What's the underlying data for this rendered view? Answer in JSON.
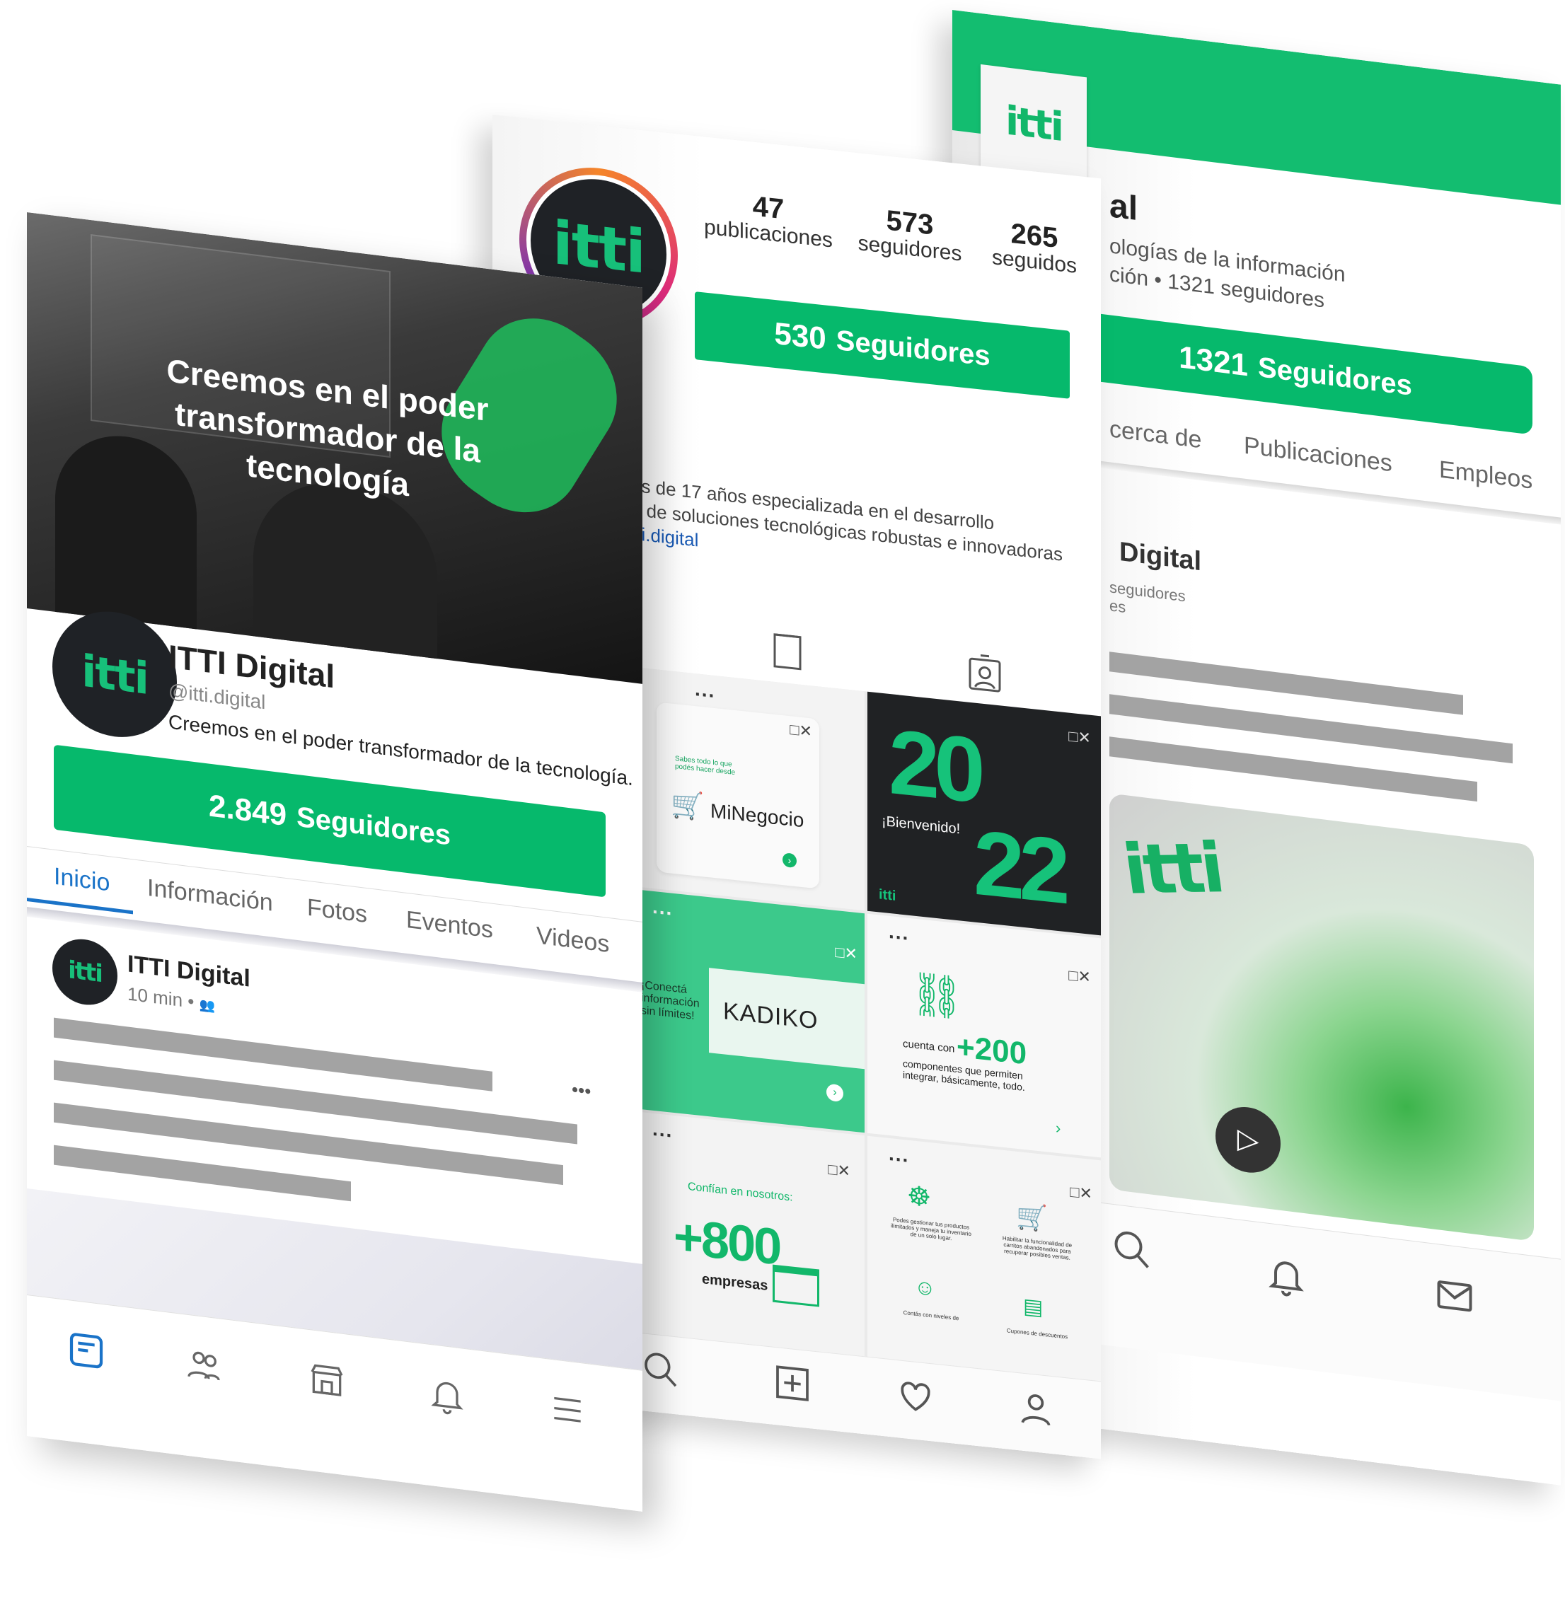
{
  "colors": {
    "brand_green": "#06b96c",
    "dark": "#1f2226",
    "link_blue": "#1a73c8"
  },
  "brand": {
    "logo_text": "itti"
  },
  "facebook": {
    "cover_text": "Creemos en el poder transformador de la tecnología",
    "page_name": "ITTI Digital",
    "handle": "@itti.digital",
    "description": "Creemos en el poder transformador de la tecnología.",
    "followers_number": "2.849",
    "followers_label": "Seguidores",
    "tabs": [
      "Inicio",
      "Información",
      "Fotos",
      "Eventos",
      "Videos"
    ],
    "post": {
      "author": "ITTI Digital",
      "time": "10 min •"
    },
    "post_menu": "•••",
    "bottom_nav_icons": [
      "news-feed-icon",
      "friends-icon",
      "marketplace-icon",
      "bell-icon",
      "menu-icon"
    ]
  },
  "instagram": {
    "stats": [
      {
        "value": "47",
        "label": "publicaciones"
      },
      {
        "value": "573",
        "label": "seguidores"
      },
      {
        "value": "265",
        "label": "seguidos"
      }
    ],
    "followers_number": "530",
    "followers_label": "Seguidores",
    "bio_line1": "ás de 17 años especializada en el desarrollo",
    "bio_line2": "n de soluciones tecnológicas robustas e innovadoras",
    "bio_link": "tti.digital",
    "grid": {
      "minegocio_small": "Sabes todo lo que podés hacer desde",
      "minegocio_brand": "MiNegocio",
      "welcome_year_top": "20",
      "welcome_year_bottom": "22",
      "welcome_text": "¡Bienvenido!",
      "kadiko_text": "¡Conectá información sin límites!",
      "kadiko_brand": "KADIKO",
      "components_prefix": "cuenta con",
      "components_number": "+200",
      "components_text": "componentes que permiten integrar, básicamente, todo.",
      "trust_title": "Confían en nosotros:",
      "trust_number": "+800",
      "trust_label": "empresas",
      "feature1": "Podes gestionar tus productos ilimitados y maneja tu inventario de un solo lugar.",
      "feature2": "Habilitar la funcionalidad de carritos abandonados para recuperar posibles ventas.",
      "feature3": "Contás con niveles de",
      "feature4": "Cupones de descuentos",
      "ad_close": "□✕",
      "tile_menu": "..."
    },
    "bottom_nav_icons": [
      "search-icon",
      "add-post-icon",
      "heart-icon",
      "profile-icon"
    ]
  },
  "linkedin": {
    "name_fragment": "al",
    "subtitle_line1": "ologías de la información",
    "subtitle_line2": "ción • 1321 seguidores",
    "followers_number": "1321",
    "followers_label": "Seguidores",
    "tabs": [
      "cerca de",
      "Publicaciones",
      "Empleos"
    ],
    "post_author": "Digital",
    "post_meta_line1": "seguidores",
    "post_meta_line2": "es",
    "bottom_nav_icons": [
      "search-icon",
      "bell-icon",
      "mail-icon"
    ]
  }
}
